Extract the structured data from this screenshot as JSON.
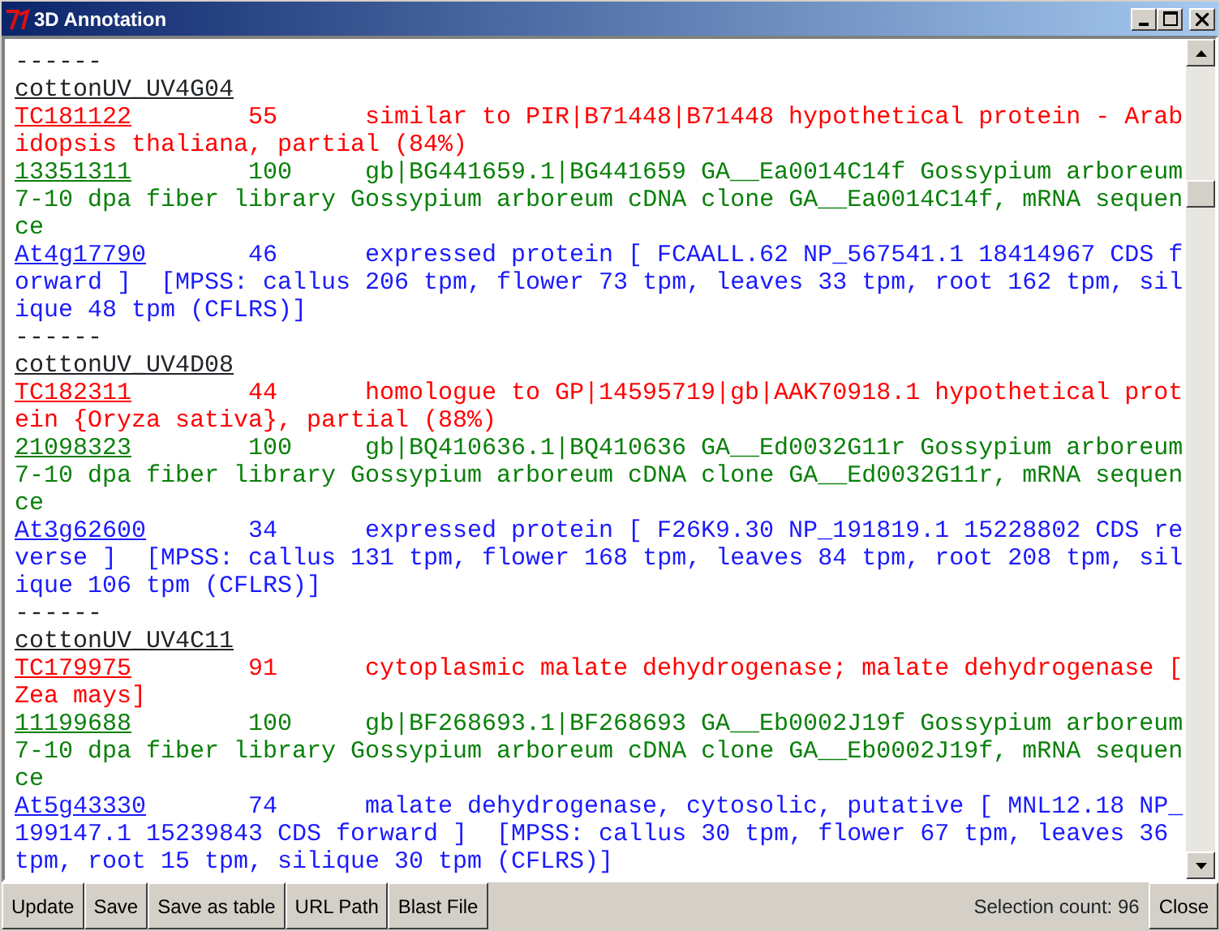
{
  "window": {
    "title": "3D Annotation"
  },
  "groups": [
    {
      "separator": "------",
      "name": "cottonUV_UV4G04",
      "hits": [
        {
          "id": "TC181122",
          "score": "55",
          "description": "similar to PIR|B71448|B71448 hypothetical protein - Arabidopsis thaliana, partial (84%)",
          "color": "#ff0000"
        },
        {
          "id": "13351311",
          "score": "100",
          "description": "gb|BG441659.1|BG441659 GA__Ea0014C14f Gossypium arboreum 7-10 dpa fiber library Gossypium arboreum cDNA clone GA__Ea0014C14f, mRNA sequence",
          "color": "#0a800a"
        },
        {
          "id": "At4g17790",
          "score": "46",
          "description": "expressed protein [ FCAALL.62 NP_567541.1 18414967 CDS forward ]  [MPSS: callus 206 tpm, flower 73 tpm, leaves 33 tpm, root 162 tpm, silique 48 tpm (CFLRS)]",
          "color": "#1a1aff"
        }
      ]
    },
    {
      "separator": "------",
      "name": "cottonUV_UV4D08",
      "hits": [
        {
          "id": "TC182311",
          "score": "44",
          "description": "homologue to GP|14595719|gb|AAK70918.1 hypothetical protein {Oryza sativa}, partial (88%)",
          "color": "#ff0000"
        },
        {
          "id": "21098323",
          "score": "100",
          "description": "gb|BQ410636.1|BQ410636 GA__Ed0032G11r Gossypium arboreum 7-10 dpa fiber library Gossypium arboreum cDNA clone GA__Ed0032G11r, mRNA sequence",
          "color": "#0a800a"
        },
        {
          "id": "At3g62600",
          "score": "34",
          "description": "expressed protein [ F26K9.30 NP_191819.1 15228802 CDS reverse ]  [MPSS: callus 131 tpm, flower 168 tpm, leaves 84 tpm, root 208 tpm, silique 106 tpm (CFLRS)]",
          "color": "#1a1aff"
        }
      ]
    },
    {
      "separator": "------",
      "name": "cottonUV_UV4C11",
      "hits": [
        {
          "id": "TC179975",
          "score": "91",
          "description": "cytoplasmic malate dehydrogenase; malate dehydrogenase [Zea mays]",
          "color": "#ff0000"
        },
        {
          "id": "11199688",
          "score": "100",
          "description": "gb|BF268693.1|BF268693 GA__Eb0002J19f Gossypium arboreum 7-10 dpa fiber library Gossypium arboreum cDNA clone GA__Eb0002J19f, mRNA sequence",
          "color": "#0a800a"
        },
        {
          "id": "At5g43330",
          "score": "74",
          "description": "malate dehydrogenase, cytosolic, putative [ MNL12.18 NP_199147.1 15239843 CDS forward ]  [MPSS: callus 30 tpm, flower 67 tpm, leaves 36 tpm, root 15 tpm, silique 30 tpm (CFLRS)]",
          "color": "#1a1aff"
        }
      ]
    }
  ],
  "buttons": [
    "Update",
    "Save",
    "Save as table",
    "URL Path",
    "Blast File"
  ],
  "selection_count": "Selection count: 96",
  "close_button": "Close"
}
